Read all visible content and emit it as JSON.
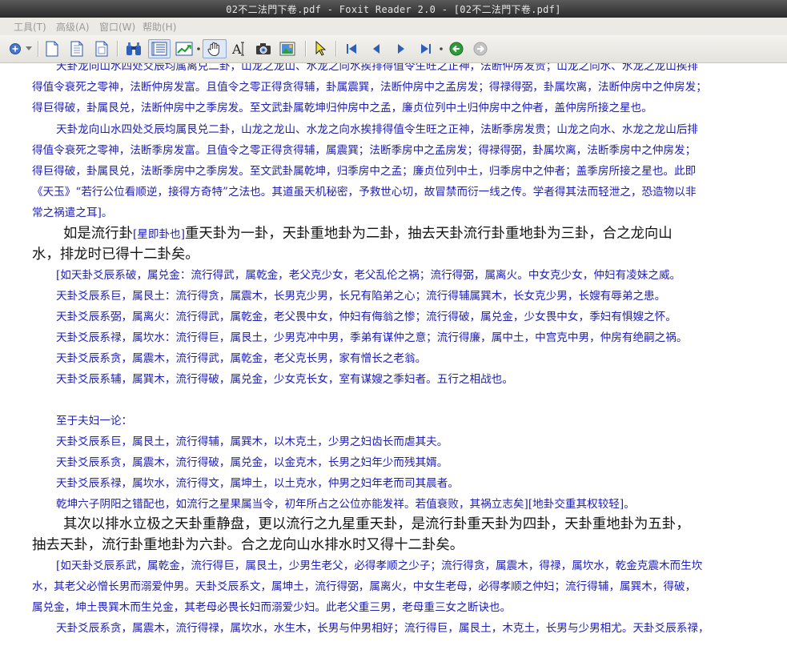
{
  "window": {
    "title": "02不二法門下卷.pdf - Foxit Reader 2.0 - [02不二法門下卷.pdf]"
  },
  "menu": {
    "items": [
      "工具(T)",
      "高级(A)",
      "窗口(W)",
      "帮助(H)"
    ]
  },
  "toolbar": {
    "icons": [
      "zoom-circle-icon",
      "dropdown-arrow-icon",
      "new-page-icon",
      "page-icon",
      "page-outline-icon",
      "binoculars-icon",
      "text-view-icon",
      "chart-icon",
      "hand-tool-icon",
      "text-select-icon",
      "camera-icon",
      "image-icon",
      "select-arrow-icon",
      "first-page-icon",
      "prev-page-icon",
      "next-page-icon",
      "last-page-icon",
      "back-icon",
      "forward-icon"
    ]
  },
  "document": {
    "lines": [
      {
        "text": "天卦龙向山水四处爻辰均属离兑二卦，山龙之龙山、水龙之向水挨排得值令生旺之正神，法断仲房发贵；山龙之向水、水龙之龙山挨排"
      },
      {
        "text": "得值令衰死之零神，法断仲房发富。且值令之零正得贪得辅，卦属震巽，法断仲房中之孟房发；得禄得弼，卦属坎离，法断仲房中之仲房发；"
      },
      {
        "text": "得巨得破，卦属艮兑，法断仲房中之季房发。至文武卦属乾坤归仲房中之孟，廉贞位列中土归仲房中之仲者，盖仲房所接之星也。"
      },
      {
        "text": "天卦龙向山水四处爻辰均属艮兑二卦，山龙之龙山、水龙之向水挨排得值令生旺之正神，法断季房发贵；山龙之向水、水龙之龙山后排"
      },
      {
        "text": "得值令衰死之零神，法断季房发富。且值令之零正得贪得辅，属震巽；法断季房中之孟房发；得禄得弼，卦属坎离，法断季房中之仲房发；"
      },
      {
        "text": "得巨得破，卦属艮兑，法断季房中之季房发。至文武卦属乾坤，归季房中之孟；廉贞位列中土，归季房中之仲者；盖季房所接之星也。此即"
      },
      {
        "text": "《天玉》“若行公位看顺逆，接得方奇特”之法也。其道虽天机秘密，予救世心切，故冒禁而衍一线之传。学者得其法而轻泄之，恐造物以非"
      },
      {
        "text": "常之祸遣之耳]。"
      },
      {
        "text": "如是流行卦",
        "inline": "[星即卦也]",
        "after": "重天卦为一卦，天卦重地卦为二卦，抽去天卦流行卦重地卦为三卦，合之龙向山"
      },
      {
        "text": "水，排龙时已得十二卦矣。"
      },
      {
        "text": "[如天卦爻辰系破，属兑金：流行得武，属乾金，老父克少女，老父乱伦之祸；流行得弼，属离火。中女克少女，仲妇有凌妹之威。"
      },
      {
        "text": "天卦爻辰系巨，属艮土：流行得贪，属震木，长男克少男，长兄有陷弟之心；流行得辅属巽木，长女克少男，长嫂有辱弟之患。"
      },
      {
        "text": "天卦爻辰系弼，属离火：流行得武，属乾金，老父畏中女，仲妇有侮翁之惨；流行得破，属兑金，少女畏中女，季妇有惧嫂之怀。"
      },
      {
        "text": "天卦爻辰系禄，属坎水：流行得巨，属艮土，少男克冲中男，季弟有谋仲之意；流行得廉，属中土，中宫克中男，仲房有绝嗣之祸。"
      },
      {
        "text": "天卦爻辰系贪，属震木，流行得武，属乾金，老父克长男，家有憎长之老翁。"
      },
      {
        "text": "天卦爻辰系辅，属巽木，流行得破，属兑金，少女克长女，室有谋嫂之季妇者。五行之相战也。"
      },
      {
        "text": "至于夫妇一论："
      },
      {
        "text": "天卦爻辰系巨，属艮土，流行得辅，属巽木，以木克土，少男之妇齿长而虐其夫。"
      },
      {
        "text": "天卦爻辰系贪，属震木，流行得破，属兑金，以金克木，长男之妇年少而残其婿。"
      },
      {
        "text": "天卦爻辰系禄，属坎水，流行得文，属坤土，以土克水，仲男之妇年老而司其晨者。"
      },
      {
        "text": "乾坤六子阴阳之错配也，如流行之星果属当令，初年所占之公位亦能发祥。若值衰败，其祸立志矣][地卦交重其权较轻]。"
      },
      {
        "text": "其次以排水立极之天卦重静盘，更以流行之九星重天卦，是流行卦重天卦为四卦，天卦重地卦为五卦，"
      },
      {
        "text": "抽去天卦，流行卦重地卦为六卦。合之龙向山水排水时又得十二卦矣。"
      },
      {
        "text": "[如天卦爻辰系武，属乾金，流行得巨，属艮土，少男生老父，必得孝顺之少子；流行得贪，属震木，得禄，属坎水，乾金克震木而生坎"
      },
      {
        "text": "水，其老父必憎长男而溺爱仲男。天卦爻辰系文，属坤土，流行得弼，属离火，中女生老母，必得孝顺之仲妇；流行得辅，属巽木，得破，"
      },
      {
        "text": "属兑金，坤土畏巽木而生兑金，其老母必畏长妇而溺爱少妇。此老父重三男，老母重三女之断诀也。"
      },
      {
        "text": "天卦爻辰系贪，属震木，流行得禄，属坎水，水生木，长男与仲男相好；流行得巨，属艮土，木克土，长男与少男相尤。天卦爻辰系禄，"
      }
    ]
  }
}
